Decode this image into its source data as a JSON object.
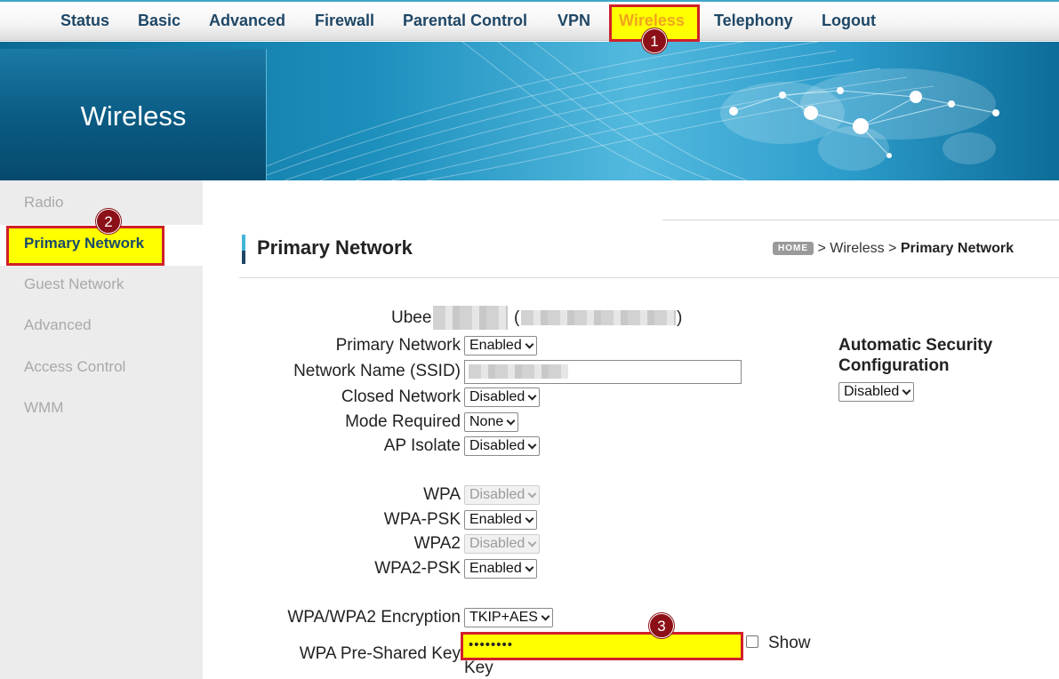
{
  "nav": {
    "items": [
      {
        "label": "Status"
      },
      {
        "label": "Basic"
      },
      {
        "label": "Advanced"
      },
      {
        "label": "Firewall"
      },
      {
        "label": "Parental Control"
      },
      {
        "label": "VPN"
      },
      {
        "label": "Wireless",
        "active": true
      },
      {
        "label": "Telephony"
      },
      {
        "label": "Logout"
      }
    ]
  },
  "callouts": [
    "1",
    "2",
    "3"
  ],
  "banner": {
    "title": "Wireless"
  },
  "sidebar": {
    "items": [
      {
        "label": "Radio"
      },
      {
        "label": "Primary Network",
        "active": true
      },
      {
        "label": "Guest Network"
      },
      {
        "label": "Advanced"
      },
      {
        "label": "Access Control"
      },
      {
        "label": "WMM"
      }
    ]
  },
  "page": {
    "title": "Primary Network",
    "breadcrumb": {
      "home": "HOME",
      "sep": ">",
      "parent": "Wireless",
      "current": "Primary Network"
    }
  },
  "form": {
    "device_prefix": "Ubee",
    "open_paren": "(",
    "close_paren": ")",
    "primary_network": {
      "label": "Primary Network",
      "value": "Enabled"
    },
    "ssid": {
      "label": "Network Name (SSID)"
    },
    "closed_network": {
      "label": "Closed Network",
      "value": "Disabled"
    },
    "mode_required": {
      "label": "Mode Required",
      "value": "None"
    },
    "ap_isolate": {
      "label": "AP Isolate",
      "value": "Disabled"
    },
    "wpa": {
      "label": "WPA",
      "value": "Disabled"
    },
    "wpa_psk": {
      "label": "WPA-PSK",
      "value": "Enabled"
    },
    "wpa2": {
      "label": "WPA2",
      "value": "Disabled"
    },
    "wpa2_psk": {
      "label": "WPA2-PSK",
      "value": "Enabled"
    },
    "encryption": {
      "label": "WPA/WPA2 Encryption",
      "value": "TKIP+AES"
    },
    "psk": {
      "label": "WPA Pre-Shared Key",
      "value": "••••••••",
      "show_label": "Show",
      "show_label_2": "Key"
    }
  },
  "auto_security": {
    "title": "Automatic Security Configuration",
    "value": "Disabled"
  },
  "colors": {
    "highlight": "#ffff00",
    "callout_border": "#d0202a",
    "callout_badge": "#8c1018",
    "nav_text": "#1f4766",
    "nav_active": "#f0a51e"
  }
}
